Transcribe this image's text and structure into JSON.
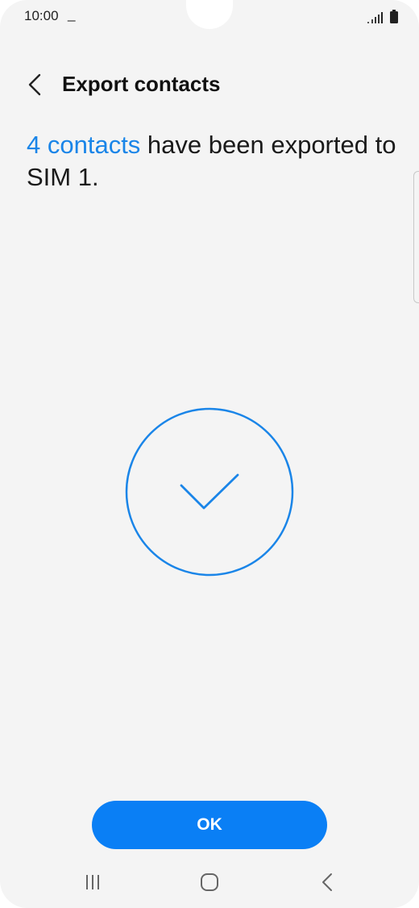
{
  "status_bar": {
    "time": "10:00",
    "notification": "_",
    "icons": [
      "signal-icon",
      "battery-icon"
    ]
  },
  "header": {
    "back_icon": "chevron-left-icon",
    "title": "Export contacts"
  },
  "message": {
    "link_text": "4 contacts",
    "rest_text": " have been exported to SIM 1."
  },
  "success": {
    "icon": "checkmark-icon",
    "color": "#1a85e8"
  },
  "actions": {
    "ok_label": "OK",
    "ok_color": "#0a7ff5"
  },
  "nav_bar": {
    "items": [
      "recent-apps-icon",
      "home-icon",
      "back-icon"
    ]
  }
}
